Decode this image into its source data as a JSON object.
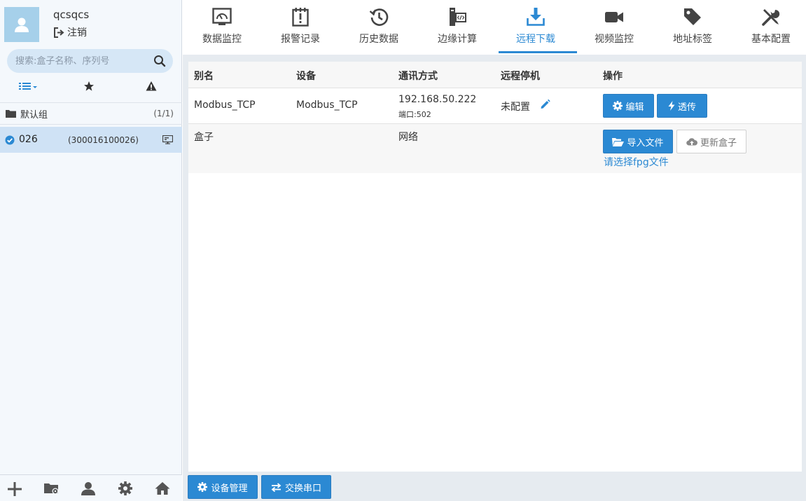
{
  "user": {
    "name": "qcsqcs",
    "logout_label": "注销"
  },
  "search": {
    "placeholder": "搜索:盒子名称、序列号"
  },
  "group": {
    "name": "默认组",
    "count": "(1/1)"
  },
  "device": {
    "name": "026",
    "serial": "(300016100026)"
  },
  "nav": {
    "items": [
      {
        "label": "数据监控",
        "icon": "monitor-gauge-icon"
      },
      {
        "label": "报警记录",
        "icon": "alarm-clipboard-icon"
      },
      {
        "label": "历史数据",
        "icon": "history-clock-icon"
      },
      {
        "label": "边缘计算",
        "icon": "edge-compute-icon"
      },
      {
        "label": "远程下载",
        "icon": "download-icon"
      },
      {
        "label": "视频监控",
        "icon": "video-camera-icon"
      },
      {
        "label": "地址标签",
        "icon": "tag-icon"
      },
      {
        "label": "基本配置",
        "icon": "tools-icon"
      }
    ],
    "active_index": 4
  },
  "table": {
    "headers": [
      "别名",
      "设备",
      "通讯方式",
      "远程停机",
      "操作"
    ],
    "row1": {
      "alias": "Modbus_TCP",
      "device": "Modbus_TCP",
      "ip": "192.168.50.222",
      "port": "端口:502",
      "remote_stop": "未配置",
      "edit_label": "编辑",
      "passthrough_label": "透传"
    },
    "row2": {
      "alias": "盒子",
      "comm": "网络",
      "import_label": "导入文件",
      "update_label": "更新盒子",
      "hint": "请选择fpg文件"
    }
  },
  "footer": {
    "device_manage_label": "设备管理",
    "swap_serial_label": "交换串口"
  },
  "colors": {
    "accent": "#2b89d3",
    "sidebar_bg": "#f4f8fc",
    "selected_row": "#cfe2f5"
  }
}
